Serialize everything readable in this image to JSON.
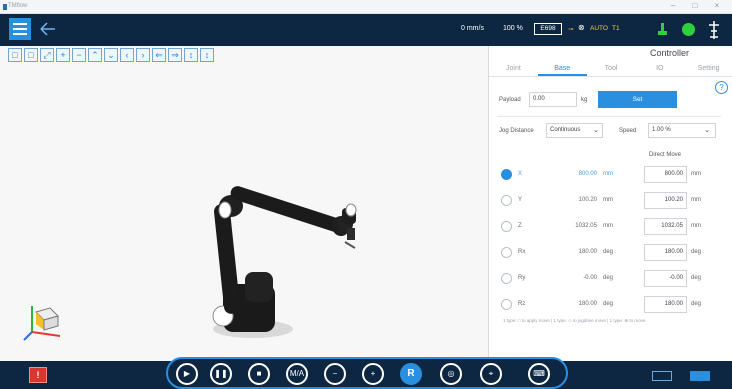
{
  "titlebar": {
    "app_name": "TMflow",
    "min": "–",
    "max": "□",
    "close": "×"
  },
  "topbar": {
    "speed": "0 mm/s",
    "percent": "100 %",
    "tool": "E698",
    "mode": "AUTO",
    "tool_frame": "T1"
  },
  "viewport_toolbar": [
    "□",
    "□",
    "⤢",
    "+",
    "−",
    "⌃",
    "⌄",
    "‹",
    "›",
    "⇐",
    "⇒",
    "↕",
    "↕"
  ],
  "panel": {
    "title": "Controller",
    "tabs": [
      {
        "label": "Joint",
        "active": false
      },
      {
        "label": "Base",
        "active": true
      },
      {
        "label": "Tool",
        "active": false
      },
      {
        "label": "IO",
        "active": false
      },
      {
        "label": "Setting",
        "active": false
      }
    ],
    "help": "?",
    "payload_label": "Payload",
    "payload_value": "0.00",
    "payload_unit": "kg",
    "set_label": "Set",
    "jog_distance_label": "Jog Distance",
    "jog_distance_value": "Continuous",
    "speed_label": "Speed",
    "speed_value": "1.00 %",
    "direct_move_label": "Direct Move",
    "axes": [
      {
        "name": "X",
        "value": "800.00",
        "unit": "mm",
        "move": "800.00",
        "move_unit": "mm",
        "selected": true
      },
      {
        "name": "Y",
        "value": "100.20",
        "unit": "mm",
        "move": "100.20",
        "move_unit": "mm",
        "selected": false
      },
      {
        "name": "Z",
        "value": "1032.05",
        "unit": "mm",
        "move": "1032.05",
        "move_unit": "mm",
        "selected": false
      },
      {
        "name": "Rx",
        "value": "180.00",
        "unit": "deg",
        "move": "180.00",
        "move_unit": "deg",
        "selected": false
      },
      {
        "name": "Ry",
        "value": "-0.00",
        "unit": "deg",
        "move": "-0.00",
        "move_unit": "deg",
        "selected": false
      },
      {
        "name": "Rz",
        "value": "180.00",
        "unit": "deg",
        "move": "180.00",
        "move_unit": "deg",
        "selected": false
      }
    ],
    "footnote": "1 type: □ to apply move  |  1 type: ◇ to jogdrive move  |  1 type: ⊕ to move"
  },
  "dock": [
    {
      "name": "play-button",
      "glyph": "▶"
    },
    {
      "name": "pause-button",
      "glyph": "❚❚"
    },
    {
      "name": "stop-button",
      "glyph": "■"
    },
    {
      "name": "manual-auto-button",
      "glyph": "M/A"
    },
    {
      "name": "speed-down-button",
      "glyph": "−"
    },
    {
      "name": "speed-up-button",
      "glyph": "+"
    },
    {
      "name": "robot-button",
      "glyph": "R"
    },
    {
      "name": "vision-button",
      "glyph": "◎"
    },
    {
      "name": "freedrive-button",
      "glyph": "⌖"
    },
    {
      "name": "keyboard-button",
      "glyph": "⌨"
    }
  ],
  "colors": {
    "accent": "#2b8fe0",
    "navbar": "#0d2743",
    "green": "#2fcf3e",
    "estop": "#d9362f"
  }
}
